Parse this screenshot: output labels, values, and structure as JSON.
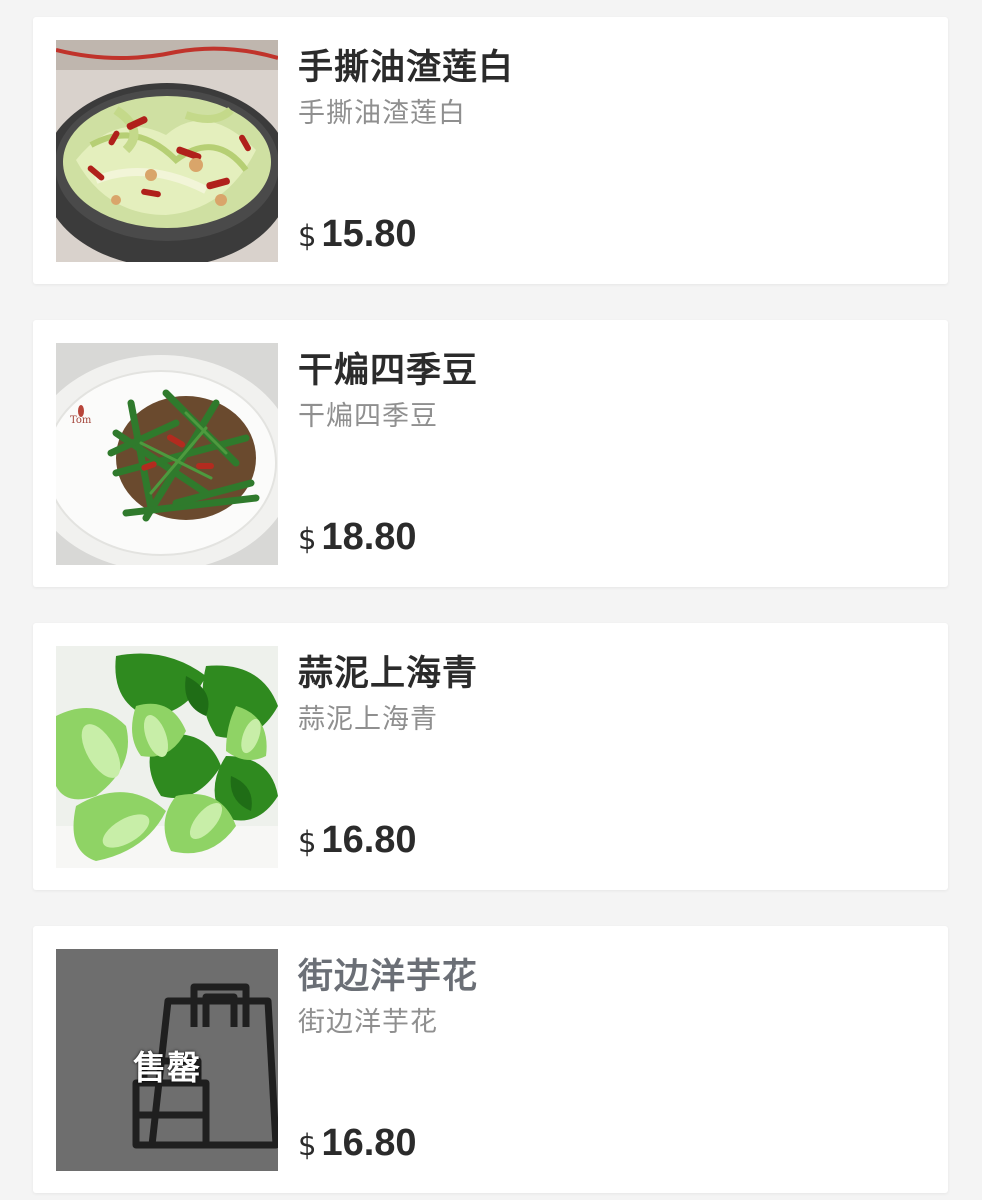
{
  "menu": {
    "items": [
      {
        "name": "手撕油渣莲白",
        "description": "手撕油渣莲白",
        "currency": "$",
        "price": "15.80",
        "image": "stir-fried-cabbage-photo",
        "sold_out": false
      },
      {
        "name": "干煸四季豆",
        "description": "干煸四季豆",
        "currency": "$",
        "price": "18.80",
        "image": "dry-fried-green-beans-photo",
        "sold_out": false
      },
      {
        "name": "蒜泥上海青",
        "description": "蒜泥上海青",
        "currency": "$",
        "price": "16.80",
        "image": "garlic-bok-choy-photo",
        "sold_out": false
      },
      {
        "name": "街边洋芋花",
        "description": "街边洋芋花",
        "currency": "$",
        "price": "16.80",
        "image": "shopping-bag-placeholder-icon",
        "sold_out": true,
        "sold_out_label": "售罄"
      }
    ]
  },
  "colors": {
    "background": "#f4f4f4",
    "card": "#ffffff",
    "title_text": "#2b2b2b",
    "description_text": "#8f8f8f",
    "sold_out_overlay": "#6e6e6e"
  }
}
